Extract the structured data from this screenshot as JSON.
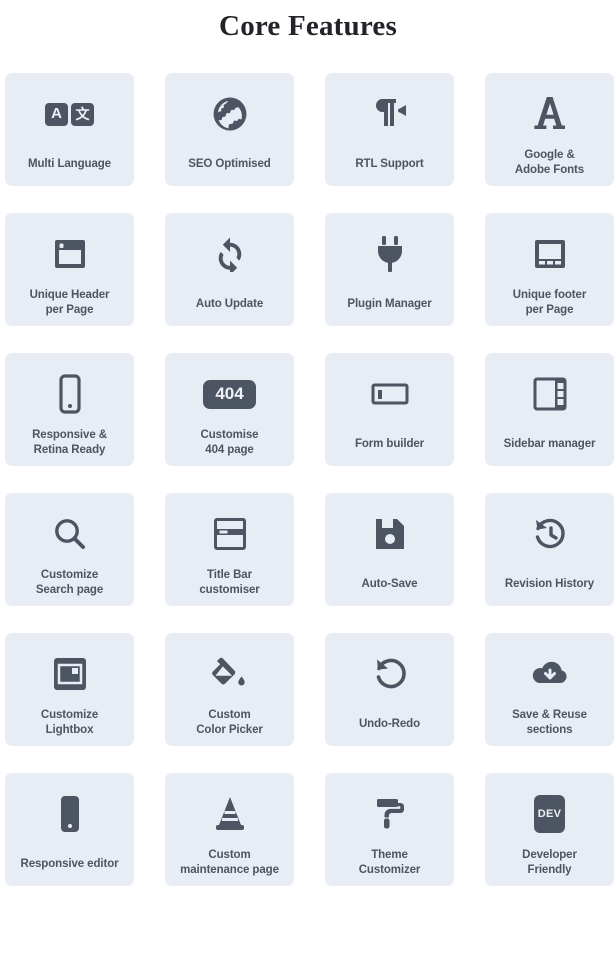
{
  "header": {
    "title": "Core Features"
  },
  "theme": {
    "page_background": "#ffffff",
    "card_background": "#e8ecf4",
    "icon_color": "#4d5562",
    "label_color": "#4d5562",
    "title_color": "#222429"
  },
  "features": [
    {
      "id": "multi-language",
      "label": "Multi Language",
      "icon": "translate-icon",
      "icon_text_a": "A",
      "icon_text_b": "文"
    },
    {
      "id": "seo-optimised",
      "label": "SEO Optimised",
      "icon": "globe-icon"
    },
    {
      "id": "rtl-support",
      "label": "RTL Support",
      "icon": "paragraph-rtl-icon"
    },
    {
      "id": "google-adobe-fonts",
      "label": "Google &\nAdobe Fonts",
      "icon": "font-letter-a-icon"
    },
    {
      "id": "unique-header",
      "label": "Unique Header\nper Page",
      "icon": "window-header-icon"
    },
    {
      "id": "auto-update",
      "label": "Auto Update",
      "icon": "refresh-sync-icon"
    },
    {
      "id": "plugin-manager",
      "label": "Plugin Manager",
      "icon": "plug-icon"
    },
    {
      "id": "unique-footer",
      "label": "Unique footer\nper Page",
      "icon": "window-footer-icon"
    },
    {
      "id": "responsive-retina",
      "label": "Responsive &\nRetina Ready",
      "icon": "mobile-phone-outline-icon"
    },
    {
      "id": "customise-404",
      "label": "Customise\n404 page",
      "icon": "badge-404-icon",
      "icon_text": "404"
    },
    {
      "id": "form-builder",
      "label": "Form builder",
      "icon": "form-input-icon"
    },
    {
      "id": "sidebar-manager",
      "label": "Sidebar manager",
      "icon": "sidebar-layout-icon"
    },
    {
      "id": "customize-search",
      "label": "Customize\nSearch page",
      "icon": "magnifier-icon"
    },
    {
      "id": "title-bar",
      "label": "Title Bar\ncustomiser",
      "icon": "window-titlebar-icon"
    },
    {
      "id": "auto-save",
      "label": "Auto-Save",
      "icon": "floppy-disk-icon"
    },
    {
      "id": "revision-history",
      "label": "Revision History",
      "icon": "history-clock-icon"
    },
    {
      "id": "customize-lightbox",
      "label": "Customize\nLightbox",
      "icon": "lightbox-image-icon"
    },
    {
      "id": "color-picker",
      "label": "Custom\nColor Picker",
      "icon": "paint-bucket-icon"
    },
    {
      "id": "undo-redo",
      "label": "Undo-Redo",
      "icon": "undo-arrow-icon"
    },
    {
      "id": "save-reuse",
      "label": "Save & Reuse\nsections",
      "icon": "cloud-download-icon"
    },
    {
      "id": "responsive-editor",
      "label": "Responsive editor",
      "icon": "mobile-phone-filled-icon"
    },
    {
      "id": "maintenance-page",
      "label": "Custom\nmaintenance page",
      "icon": "traffic-cone-icon"
    },
    {
      "id": "theme-customizer",
      "label": "Theme\nCustomizer",
      "icon": "paint-roller-icon"
    },
    {
      "id": "developer-friendly",
      "label": "Developer\nFriendly",
      "icon": "dev-badge-icon",
      "icon_text": "DEV"
    }
  ]
}
